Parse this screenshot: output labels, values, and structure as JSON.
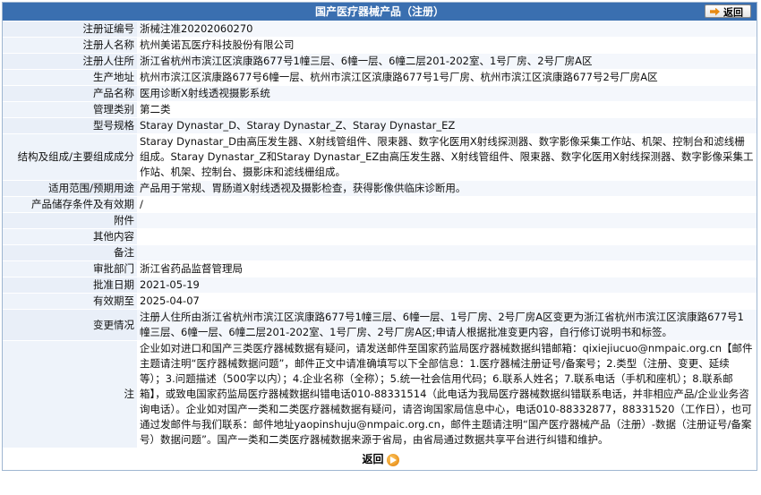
{
  "header": {
    "title": "国产医疗器械产品（注册）",
    "back_label": "返回"
  },
  "rows": [
    {
      "label": "注册证编号",
      "value": "浙械注准20202060270"
    },
    {
      "label": "注册人名称",
      "value": "杭州美诺瓦医疗科技股份有限公司"
    },
    {
      "label": "注册人住所",
      "value": "浙江省杭州市滨江区滨康路677号1幢三层、6幢一层、6幢二层201-202室、1号厂房、2号厂房A区"
    },
    {
      "label": "生产地址",
      "value": "杭州市滨江区滨康路677号6幢一层、杭州市滨江区滨康路677号1号厂房、杭州市滨江区滨康路677号2号厂房A区"
    },
    {
      "label": "产品名称",
      "value": "医用诊断X射线透视摄影系统"
    },
    {
      "label": "管理类别",
      "value": "第二类"
    },
    {
      "label": "型号规格",
      "value": "Staray Dynastar_D、Staray Dynastar_Z、Staray Dynastar_EZ"
    },
    {
      "label": "结构及组成/主要组成成分",
      "value": "Staray Dynastar_D由高压发生器、X射线管组件、限束器、数字化医用X射线探测器、数字影像采集工作站、机架、控制台和滤线栅组成。Staray Dynastar_Z和Staray Dynastar_EZ由高压发生器、X射线管组件、限束器、数字化医用X射线探测器、数字影像采集工作站、机架、控制台、摄影床和滤线栅组成。"
    },
    {
      "label": "适用范围/预期用途",
      "value": "产品用于常规、胃肠道X射线透视及摄影检查，获得影像供临床诊断用。"
    },
    {
      "label": "产品储存条件及有效期",
      "value": "/"
    },
    {
      "label": "附件",
      "value": ""
    },
    {
      "label": "其他内容",
      "value": ""
    },
    {
      "label": "备注",
      "value": ""
    },
    {
      "label": "审批部门",
      "value": "浙江省药品监督管理局"
    },
    {
      "label": "批准日期",
      "value": "2021-05-19"
    },
    {
      "label": "有效期至",
      "value": "2025-04-07"
    },
    {
      "label": "变更情况",
      "value": "注册人住所由浙江省杭州市滨江区滨康路677号1幢三层、6幢一层、1号厂房、2号厂房A区变更为浙江省杭州市滨江区滨康路677号1幢三层、6幢一层、6幢二层201-202室、1号厂房、2号厂房A区;申请人根据批准变更内容，自行修订说明书和标签。"
    },
    {
      "label": "注",
      "value": "企业如对进口和国产三类医疗器械数据有疑问，请发送邮件至国家药监局医疗器械数据纠错邮箱：qixiejiucuo@nmpaic.org.cn【邮件主题请注明“医疗器械数据问题”，邮件正文中请准确填写以下全部信息：1.医疗器械注册证号/备案号；2.类型（注册、变更、延续等）；3.问题描述（500字以内）；4.企业名称（全称）；5.统一社会信用代码；6.联系人姓名；7.联系电话（手机和座机）；8.联系邮箱】，或致电国家药监局医疗器械数据纠错电话010-88331514（此电话为我局医疗器械数据纠错联系电话，并非相应产品/企业业务咨询电话）。企业如对国产一类和二类医疗器械数据有疑问，请咨询国家局信息中心，电话010-88332877，88331520（工作日），也可通过发邮件与我们联系：邮件地址yaopinshuju@nmpaic.org.cn，邮件主题请注明“国产医疗器械产品（注册）-数据（注册证号/备案号）数据问题”。国产一类和二类医疗器械数据来源于省局，由省局通过数据共享平台进行纠错和维护。"
    }
  ],
  "footer": {
    "back_label": "返回"
  }
}
